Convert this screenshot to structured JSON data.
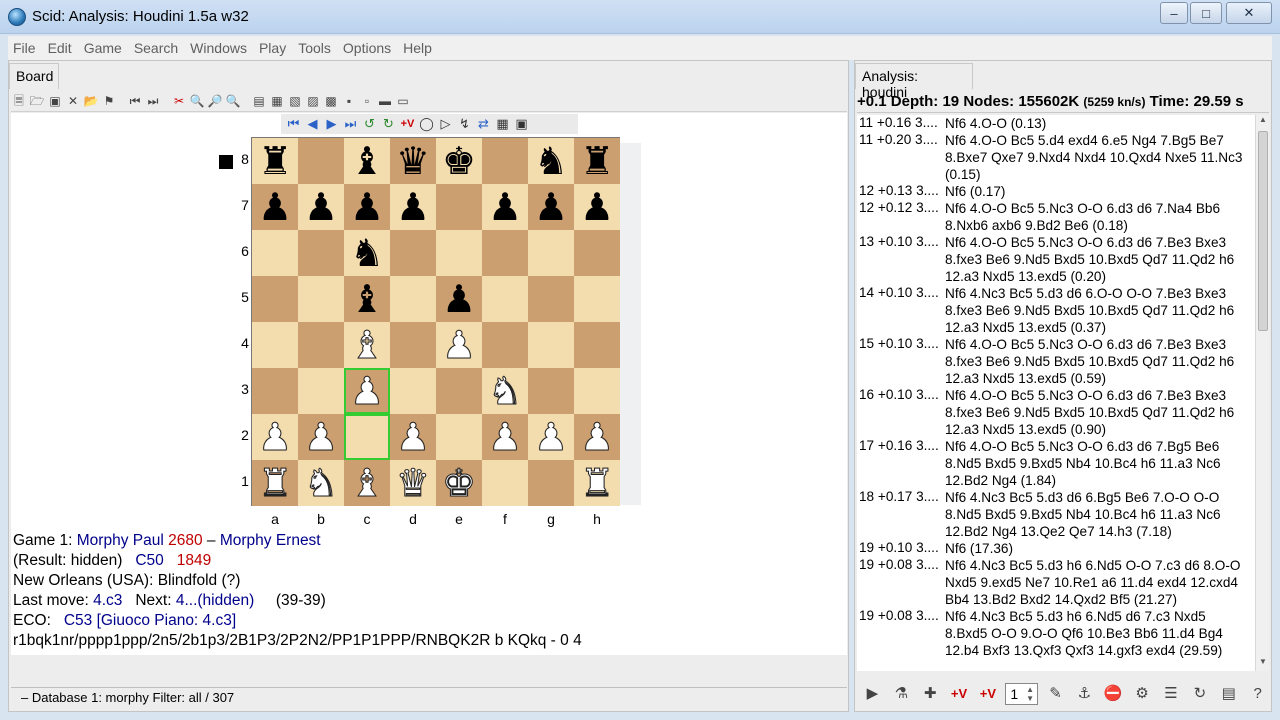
{
  "window": {
    "title": "Scid: Analysis: Houdini 1.5a w32"
  },
  "menu": [
    "File",
    "Edit",
    "Game",
    "Search",
    "Windows",
    "Play",
    "Tools",
    "Options",
    "Help"
  ],
  "tabs": {
    "board": "Board",
    "analysis": "Analysis: houdini"
  },
  "board": {
    "ranks": [
      "8",
      "7",
      "6",
      "5",
      "4",
      "3",
      "2",
      "1"
    ],
    "files": [
      "a",
      "b",
      "c",
      "d",
      "e",
      "f",
      "g",
      "h"
    ],
    "position": [
      [
        "r",
        "",
        "b",
        "q",
        "k",
        "",
        "n",
        "r"
      ],
      [
        "p",
        "p",
        "p",
        "p",
        "",
        "p",
        "p",
        "p"
      ],
      [
        "",
        "",
        "n",
        "",
        "",
        "",
        "",
        ""
      ],
      [
        "",
        "",
        "b",
        "",
        "p",
        "",
        "",
        ""
      ],
      [
        "",
        "",
        "B",
        "",
        "P",
        "",
        "",
        ""
      ],
      [
        "",
        "",
        "P",
        "",
        "",
        "N",
        "",
        ""
      ],
      [
        "P",
        "P",
        "",
        "P",
        "",
        "P",
        "P",
        "P"
      ],
      [
        "R",
        "N",
        "B",
        "Q",
        "K",
        "",
        "",
        "R"
      ]
    ],
    "highlight": [
      "c3",
      "c2"
    ],
    "side_to_move": "black"
  },
  "game_info": {
    "game_label": "Game 1:",
    "white_player": "Morphy Paul",
    "white_elo": "2680",
    "separator": "–",
    "black_player": "Morphy Ernest",
    "result": "(Result: hidden)",
    "eco_code": "C50",
    "year": "1849",
    "site": "New Orleans (USA):  Blindfold (?)",
    "last_move_label": "Last move:",
    "last_move": "4.c3",
    "next_label": "Next:",
    "next_move": "4...(hidden)",
    "material": "(39-39)",
    "eco_label": "ECO:",
    "eco_full": "C53 [Giuoco Piano: 4.c3]",
    "fen": "r1bqk1nr/pppp1ppp/2n5/2b1p3/2B1P3/2P2N2/PP1P1PPP/RNBQK2R b KQkq - 0 4"
  },
  "status": "–  Database 1: morphy   Filter: all / 307",
  "analysis": {
    "score": "+0.1",
    "depth_label": "Depth:",
    "depth": "19",
    "nodes_label": "Nodes:",
    "nodes": "155602K",
    "kps": "(5259 kn/s)",
    "time_label": "Time:",
    "time": "29.59 s",
    "lines": [
      {
        "head": "11 +0.16 3....",
        "lines": [
          "Nf6 4.O-O  (0.13)"
        ]
      },
      {
        "head": "11 +0.20 3....",
        "lines": [
          "Nf6 4.O-O Bc5 5.d4 exd4 6.e5 Ng4 7.Bg5 Be7",
          "8.Bxe7 Qxe7 9.Nxd4 Nxd4 10.Qxd4 Nxe5 11.Nc3",
          "(0.15)"
        ]
      },
      {
        "head": "12 +0.13 3....",
        "lines": [
          "Nf6  (0.17)"
        ]
      },
      {
        "head": "12 +0.12 3....",
        "lines": [
          "Nf6 4.O-O Bc5 5.Nc3 O-O 6.d3 d6 7.Na4 Bb6",
          "8.Nxb6 axb6 9.Bd2 Be6  (0.18)"
        ]
      },
      {
        "head": "13 +0.10 3....",
        "lines": [
          "Nf6 4.O-O Bc5 5.Nc3 O-O 6.d3 d6 7.Be3 Bxe3",
          "8.fxe3 Be6 9.Nd5 Bxd5 10.Bxd5 Qd7 11.Qd2 h6",
          "12.a3 Nxd5 13.exd5  (0.20)"
        ]
      },
      {
        "head": "14 +0.10 3....",
        "lines": [
          "Nf6 4.Nc3 Bc5 5.d3 d6 6.O-O O-O 7.Be3 Bxe3",
          "8.fxe3 Be6 9.Nd5 Bxd5 10.Bxd5 Qd7 11.Qd2 h6",
          "12.a3 Nxd5 13.exd5  (0.37)"
        ]
      },
      {
        "head": "15 +0.10 3....",
        "lines": [
          "Nf6 4.O-O Bc5 5.Nc3 O-O 6.d3 d6 7.Be3 Bxe3",
          "8.fxe3 Be6 9.Nd5 Bxd5 10.Bxd5 Qd7 11.Qd2 h6",
          "12.a3 Nxd5 13.exd5  (0.59)"
        ]
      },
      {
        "head": "16 +0.10 3....",
        "lines": [
          "Nf6 4.O-O Bc5 5.Nc3 O-O 6.d3 d6 7.Be3 Bxe3",
          "8.fxe3 Be6 9.Nd5 Bxd5 10.Bxd5 Qd7 11.Qd2 h6",
          "12.a3 Nxd5 13.exd5  (0.90)"
        ]
      },
      {
        "head": "17 +0.16 3....",
        "lines": [
          "Nf6 4.O-O Bc5 5.Nc3 O-O 6.d3 d6 7.Bg5 Be6",
          "8.Nd5 Bxd5 9.Bxd5 Nb4 10.Bc4 h6 11.a3 Nc6",
          "12.Bd2 Ng4  (1.84)"
        ]
      },
      {
        "head": "18 +0.17 3....",
        "lines": [
          "Nf6 4.Nc3 Bc5 5.d3 d6 6.Bg5 Be6 7.O-O O-O",
          "8.Nd5 Bxd5 9.Bxd5 Nb4 10.Bc4 h6 11.a3 Nc6",
          "12.Bd2 Ng4 13.Qe2 Qe7 14.h3  (7.18)"
        ]
      },
      {
        "head": "19 +0.10 3....",
        "lines": [
          "Nf6  (17.36)"
        ]
      },
      {
        "head": "19 +0.08 3....",
        "lines": [
          "Nf6 4.Nc3 Bc5 5.d3 h6 6.Nd5 O-O 7.c3 d6 8.O-O",
          "Nxd5 9.exd5 Ne7 10.Re1 a6 11.d4 exd4 12.cxd4",
          "Bb4 13.Bd2 Bxd2 14.Qxd2 Bf5  (21.27)"
        ]
      },
      {
        "head": "19 +0.08 3....",
        "lines": [
          "Nf6 4.Nc3 Bc5 5.d3 h6 6.Nd5 d6 7.c3 Nxd5",
          "8.Bxd5 O-O 9.O-O Qf6 10.Be3 Bb6 11.d4 Bg4",
          "12.b4 Bxf3 13.Qxf3 Qxf3 14.gxf3 exd4  (29.59)"
        ]
      }
    ],
    "pv_count": "1"
  }
}
